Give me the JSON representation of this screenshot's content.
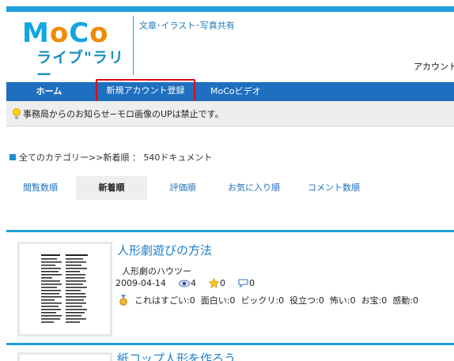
{
  "header": {
    "logo_top": "MoCo",
    "logo_bottom": "ライブ\"ラリー",
    "tagline": "文章･イラスト･写真共有",
    "account_label": "アカウント"
  },
  "nav": {
    "home": "ホーム",
    "register": "新規アカウント登録",
    "video": "MoCoビデオ"
  },
  "notice": {
    "text": "事務局からのお知らせ−モロ画像のUPは禁止です。"
  },
  "breadcrumb": {
    "text": "全てのカテゴリー>>新着順 ： 540ドキュメント"
  },
  "sort_tabs": [
    {
      "label": "閲覧数順"
    },
    {
      "label": "新着順"
    },
    {
      "label": "評価順"
    },
    {
      "label": "お気に入り順"
    },
    {
      "label": "コメント数順"
    }
  ],
  "documents": [
    {
      "title": "人形劇遊びの方法",
      "subtitle": "人形劇のハウツー",
      "date": "2009-04-14",
      "views": "4",
      "stars": "0",
      "comments": "0",
      "reactions": [
        "これはすごい:0",
        "面白い:0",
        "ビックリ:0",
        "役立つ:0",
        "怖い:0",
        "お宝:0",
        "感動:0"
      ]
    },
    {
      "title": "紙コップ人形を作ろう"
    }
  ],
  "colors": {
    "accent": "#1ea0dc",
    "nav_bg": "#1e6fbf",
    "highlight_box": "#e0001a",
    "logo_orange": "#f08a00"
  }
}
